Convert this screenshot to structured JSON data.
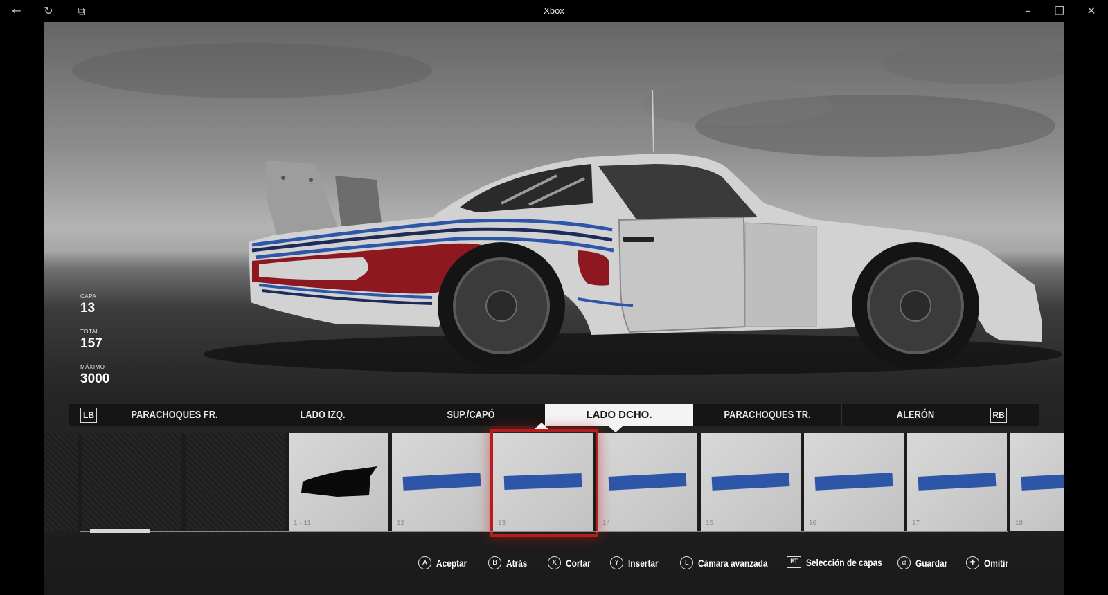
{
  "window": {
    "title": "Xbox",
    "icons": [
      "back-arrow-icon",
      "refresh-icon",
      "mini-view-icon",
      "minimize-icon",
      "restore-icon",
      "close-icon"
    ]
  },
  "stats": [
    {
      "label": "CAPA",
      "value": "13"
    },
    {
      "label": "TOTAL",
      "value": "157"
    },
    {
      "label": "MÁXIMO",
      "value": "3000"
    }
  ],
  "tabs": {
    "left_bumper": "LB",
    "right_bumper": "RB",
    "items": [
      {
        "label": "PARACHOQUES FR.",
        "active": false
      },
      {
        "label": "LADO IZQ.",
        "active": false
      },
      {
        "label": "SUP./CAPÓ",
        "active": false
      },
      {
        "label": "LADO DCHO.",
        "active": true
      },
      {
        "label": "PARACHOQUES TR.",
        "active": false
      },
      {
        "label": "ALERÓN",
        "active": false
      }
    ]
  },
  "layers": [
    {
      "label": "",
      "kind": "empty"
    },
    {
      "label": "",
      "kind": "empty"
    },
    {
      "label": "1 - 11",
      "kind": "group"
    },
    {
      "label": "12",
      "kind": "stripe"
    },
    {
      "label": "13",
      "kind": "stripe",
      "selected": true
    },
    {
      "label": "14",
      "kind": "stripe"
    },
    {
      "label": "15",
      "kind": "stripe"
    },
    {
      "label": "16",
      "kind": "stripe"
    },
    {
      "label": "17",
      "kind": "stripe"
    },
    {
      "label": "18",
      "kind": "stripe"
    }
  ],
  "actions": [
    {
      "glyph": "A",
      "label": "Aceptar"
    },
    {
      "glyph": "B",
      "label": "Atrás"
    },
    {
      "glyph": "X",
      "label": "Cortar"
    },
    {
      "glyph": "Y",
      "label": "Insertar"
    },
    {
      "glyph": "L",
      "label": "Cámara avanzada"
    },
    {
      "glyph": "RT",
      "label": "Selección de capas"
    },
    {
      "glyph": "⧉",
      "label": "Guardar"
    },
    {
      "glyph": "✚",
      "label": "Omitir"
    }
  ],
  "colors": {
    "accent_selected": "#b81c1c",
    "stripe_blue": "#2e56a8",
    "livery_red": "#8e1820",
    "car_white": "#d2d2d2"
  }
}
